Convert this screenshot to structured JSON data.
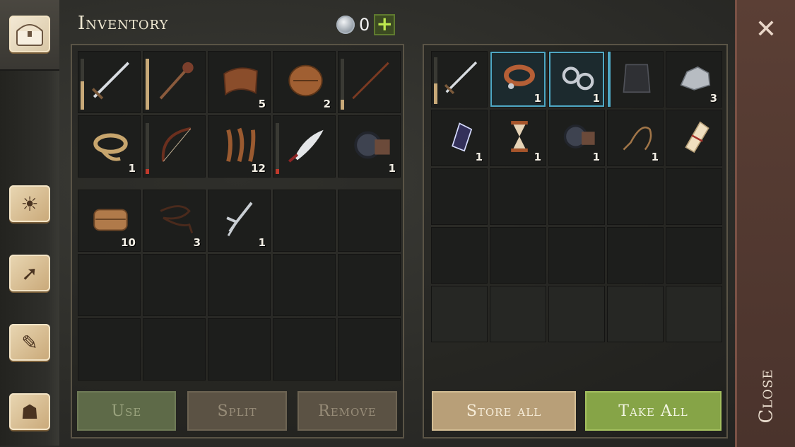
{
  "header": {
    "title": "Inventory",
    "currency_value": "0",
    "add_label": "+"
  },
  "rail": {
    "tabs": [
      {
        "name": "chest-tab",
        "glyph": "▣"
      },
      {
        "name": "skills-tab",
        "glyph": "☀"
      },
      {
        "name": "map-tab",
        "glyph": "➚"
      },
      {
        "name": "quests-tab",
        "glyph": "✎"
      },
      {
        "name": "character-tab",
        "glyph": "☗"
      }
    ]
  },
  "left_top": [
    {
      "name": "sword",
      "icon": "sword",
      "durability": 0.55,
      "dur_color": "#c8a978",
      "count": ""
    },
    {
      "name": "mace",
      "icon": "mace",
      "durability": 1.0,
      "dur_color": "#c8a978",
      "count": ""
    },
    {
      "name": "leather",
      "icon": "leather",
      "count": "5"
    },
    {
      "name": "barrel",
      "icon": "barrel",
      "count": "2"
    },
    {
      "name": "staff",
      "icon": "staff",
      "durability": 0.2,
      "dur_color": "#c8a978",
      "count": ""
    },
    {
      "name": "rope",
      "icon": "rope",
      "count": "1"
    },
    {
      "name": "bow",
      "icon": "bow",
      "durability": 0.1,
      "dur_color": "#c0392b",
      "count": ""
    },
    {
      "name": "fibers",
      "icon": "fibers",
      "count": "12"
    },
    {
      "name": "scimitar",
      "icon": "scimitar",
      "durability": 0.1,
      "dur_color": "#c0392b",
      "count": ""
    },
    {
      "name": "gear",
      "icon": "gear",
      "count": "1"
    }
  ],
  "left_bottom": [
    {
      "name": "cloth",
      "icon": "cloth",
      "count": "10"
    },
    {
      "name": "string",
      "icon": "string",
      "count": "3"
    },
    {
      "name": "fork",
      "icon": "fork",
      "count": "1"
    }
  ],
  "right": [
    {
      "name": "sword",
      "icon": "sword",
      "durability": 0.45,
      "dur_color": "#c8a978",
      "count": ""
    },
    {
      "name": "collar",
      "icon": "collar",
      "count": "1",
      "highlight": true
    },
    {
      "name": "shackles",
      "icon": "shackles",
      "count": "1",
      "highlight": true
    },
    {
      "name": "chainmail",
      "icon": "chainmail",
      "count": "",
      "hl_left": true
    },
    {
      "name": "ore",
      "icon": "ore",
      "count": "3"
    },
    {
      "name": "crystal",
      "icon": "crystal",
      "count": "1"
    },
    {
      "name": "hourglass",
      "icon": "hourglass",
      "count": "1"
    },
    {
      "name": "gear",
      "icon": "gear",
      "count": "1"
    },
    {
      "name": "whip",
      "icon": "whip",
      "count": "1"
    },
    {
      "name": "scroll",
      "icon": "scroll",
      "count": ""
    }
  ],
  "buttons": {
    "use": "Use",
    "split": "Split",
    "remove": "Remove",
    "store_all": "Store all",
    "take_all": "Take All"
  },
  "close": {
    "x": "✕",
    "label": "Close"
  }
}
